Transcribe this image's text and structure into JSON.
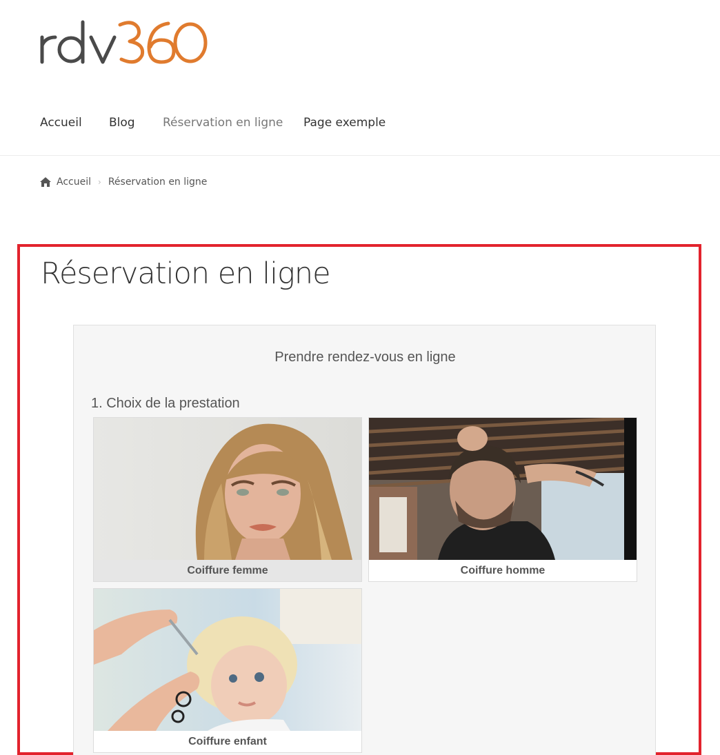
{
  "header": {
    "logo": {
      "text_part": "rdv",
      "number_part": "360",
      "text_color": "#4a4a4a",
      "number_color": "#e07b2e"
    },
    "nav": [
      {
        "label": "Accueil",
        "active": false
      },
      {
        "label": "Blog",
        "active": false
      },
      {
        "label": "Réservation en ligne",
        "active": true
      },
      {
        "label": "Page exemple",
        "active": false
      }
    ]
  },
  "breadcrumb": {
    "icon": "home-icon",
    "home_label": "Accueil",
    "current": "Réservation en ligne"
  },
  "page": {
    "title": "Réservation en ligne",
    "highlight_color": "#e2232d"
  },
  "booking_widget": {
    "title": "Prendre rendez-vous en ligne",
    "step_title": "1. Choix de la prestation",
    "services": [
      {
        "label": "Coiffure femme",
        "selected": true
      },
      {
        "label": "Coiffure homme",
        "selected": false
      },
      {
        "label": "Coiffure enfant",
        "selected": false
      }
    ]
  }
}
